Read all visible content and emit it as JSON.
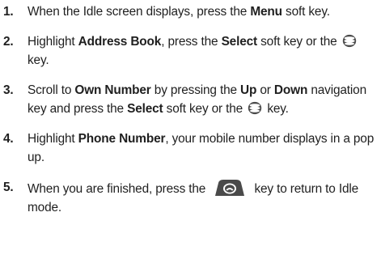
{
  "steps": [
    {
      "number": "1.",
      "parts": {
        "t1": "When the Idle screen displays, press the ",
        "b1": "Menu",
        "t2": " soft key."
      }
    },
    {
      "number": "2.",
      "parts": {
        "t1": "Highlight ",
        "b1": "Address Book",
        "t2": ", press the ",
        "b2": "Select",
        "t3": " soft key or the ",
        "icon": "select-key-icon",
        "t4": " key."
      }
    },
    {
      "number": "3.",
      "parts": {
        "t1": "Scroll to ",
        "b1": "Own Number",
        "t2": " by pressing the ",
        "b2": "Up",
        "t3": " or ",
        "b3": "Down",
        "t4": " navigation key and press the ",
        "b4": "Select",
        "t5": " soft key or the ",
        "icon": "select-key-icon",
        "t6": " key."
      }
    },
    {
      "number": "4.",
      "parts": {
        "t1": "Highlight ",
        "b1": "Phone Number",
        "t2": ", your mobile number displays in a pop up."
      }
    },
    {
      "number": "5.",
      "parts": {
        "t1": "When you are finished, press the ",
        "icon": "end-key-icon",
        "t2": " key to return to Idle mode."
      }
    }
  ],
  "colors": {
    "text": "#1f1f1f",
    "icon_fill": "#4a4a4a"
  }
}
